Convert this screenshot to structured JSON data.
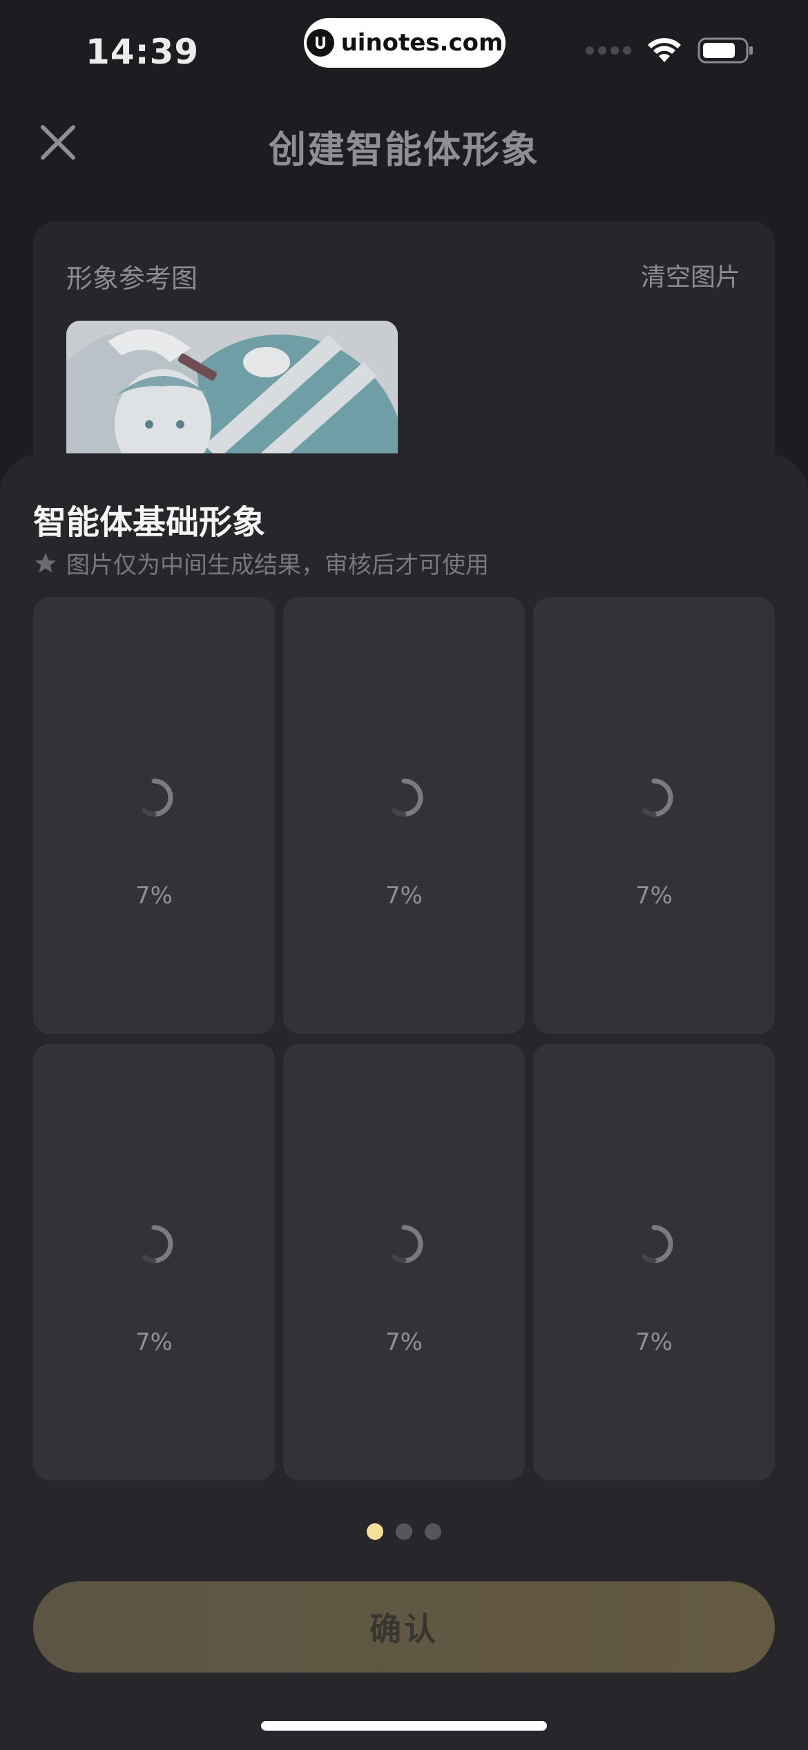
{
  "status_bar": {
    "time": "14:39",
    "watermark": "uinotes.com",
    "icons": [
      "signal-icon",
      "wifi-icon",
      "battery-icon"
    ]
  },
  "nav": {
    "title": "创建智能体形象",
    "close_icon": "close-icon"
  },
  "reference": {
    "label": "形象参考图",
    "clear_label": "清空图片"
  },
  "sheet": {
    "title": "智能体基础形象",
    "subtitle": "图片仅为中间生成结果，审核后才可使用",
    "subtitle_icon": "star-icon",
    "tiles": [
      {
        "progress": "7%"
      },
      {
        "progress": "7%"
      },
      {
        "progress": "7%"
      },
      {
        "progress": "7%"
      },
      {
        "progress": "7%"
      },
      {
        "progress": "7%"
      }
    ],
    "pagination": {
      "count": 3,
      "active": 0
    },
    "confirm_label": "确认"
  },
  "colors": {
    "background": "#1d1d21",
    "sheet": "#26262b",
    "tile": "#323238",
    "accent_dot": "#f6df9a",
    "confirm_button": "#5f5643"
  }
}
